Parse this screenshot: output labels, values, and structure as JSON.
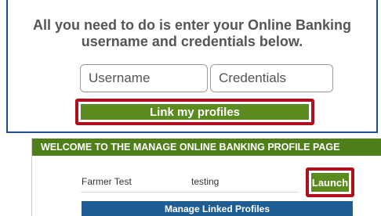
{
  "login_panel": {
    "instructions_line1": "All you need to do is enter your Online Banking",
    "instructions_line2": "username and credentials below.",
    "username_placeholder": "Username",
    "credentials_placeholder": "Credentials",
    "link_button_label": "Link my profiles"
  },
  "manage_panel": {
    "header": "WELCOME TO THE MANAGE ONLINE BANKING PROFILE PAGE",
    "profiles": [
      {
        "name": "Farmer Test",
        "username": "testing",
        "action_label": "Launch"
      }
    ],
    "manage_button_label": "Manage Linked Profiles"
  },
  "colors": {
    "accent_green": "#5b8a1e",
    "highlight_red": "#b0101e",
    "panel_border_blue": "#1f4e8c",
    "manage_button_blue": "#1f5d95"
  }
}
